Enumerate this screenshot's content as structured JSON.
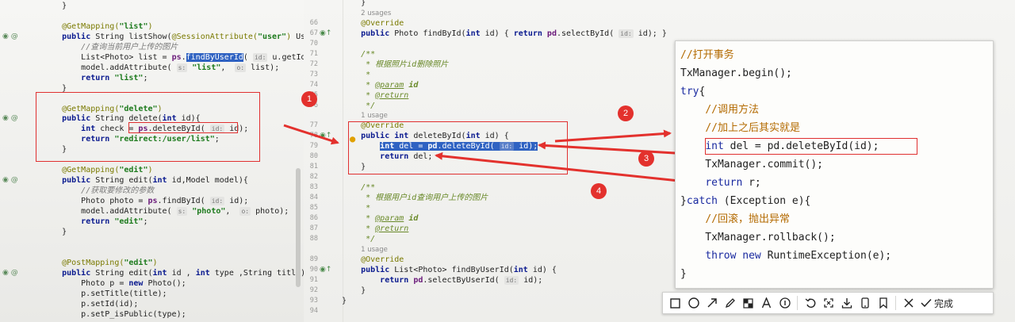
{
  "left_code": {
    "lines": [
      {
        "n": "",
        "html": "    }"
      },
      {
        "n": "",
        "html": ""
      },
      {
        "n": "",
        "html": "    <span class='tk-ann'>@GetMapping(</span><span class='tk-str'>\"list\"</span><span class='tk-ann'>)</span>"
      },
      {
        "n": "",
        "html": "    <span class='tk-kw'>public</span> String listShow(<span class='tk-ann'>@SessionAttribute(</span><span class='tk-str'>\"user\"</span><span class='tk-ann'>)</span> Use"
      },
      {
        "n": "",
        "html": "        <span class='tk-cmt'>//查询当前用户上传的图片</span>"
      },
      {
        "n": "",
        "html": "        List&lt;Photo&gt; list = <span class='tk-field'>ps</span>.<span class='tk-sel'>findByUserId</span>( <span class='tk-hint'>id:</span> u.getId()"
      },
      {
        "n": "",
        "html": "        model.addAttribute( <span class='tk-hint'>s:</span> <span class='tk-str'>\"list\"</span>,  <span class='tk-hint'>o:</span> list);"
      },
      {
        "n": "",
        "html": "        <span class='tk-kw'>return</span> <span class='tk-str'>\"list\"</span>;"
      },
      {
        "n": "",
        "html": "    }"
      },
      {
        "n": "",
        "html": ""
      },
      {
        "n": "",
        "html": "    <span class='tk-ann'>@GetMapping(</span><span class='tk-str'>\"delete\"</span><span class='tk-ann'>)</span>"
      },
      {
        "n": "",
        "html": "    <span class='tk-kw'>public</span> String delete(<span class='tk-kw'>int</span> id){"
      },
      {
        "n": "",
        "html": "        <span class='tk-kw'>int</span> check = <span class='tk-field'>ps</span>.deleteById( <span class='tk-hint'>id:</span> id);"
      },
      {
        "n": "",
        "html": "        <span class='tk-kw'>return</span> <span class='tk-str'>\"redirect:/user/list\"</span>;"
      },
      {
        "n": "",
        "html": "    }"
      },
      {
        "n": "",
        "html": ""
      },
      {
        "n": "",
        "html": "    <span class='tk-ann'>@GetMapping(</span><span class='tk-str'>\"edit\"</span><span class='tk-ann'>)</span>"
      },
      {
        "n": "",
        "html": "    <span class='tk-kw'>public</span> String edit(<span class='tk-kw'>int</span> id,Model model){"
      },
      {
        "n": "",
        "html": "        <span class='tk-cmt'>//获取要修改的参数</span>"
      },
      {
        "n": "",
        "html": "        Photo photo = <span class='tk-field'>ps</span>.findById( <span class='tk-hint'>id:</span> id);"
      },
      {
        "n": "",
        "html": "        model.addAttribute( <span class='tk-hint'>s:</span> <span class='tk-str'>\"photo\"</span>,  <span class='tk-hint'>o:</span> photo);"
      },
      {
        "n": "",
        "html": "        <span class='tk-kw'>return</span> <span class='tk-str'>\"edit\"</span>;"
      },
      {
        "n": "",
        "html": "    }"
      },
      {
        "n": "",
        "html": ""
      },
      {
        "n": "",
        "html": ""
      },
      {
        "n": "",
        "html": "    <span class='tk-ann'>@PostMapping(</span><span class='tk-str'>\"edit\"</span><span class='tk-ann'>)</span>"
      },
      {
        "n": "",
        "html": "    <span class='tk-kw'>public</span> String edit(<span class='tk-kw'>int</span> id , <span class='tk-kw'>int</span> type ,String title){"
      },
      {
        "n": "",
        "html": "        Photo p = <span class='tk-kw'>new</span> Photo();"
      },
      {
        "n": "",
        "html": "        p.setTitle(title);"
      },
      {
        "n": "",
        "html": "        p.setId(id);"
      },
      {
        "n": "",
        "html": "        p.setP_isPublic(type);"
      }
    ]
  },
  "right_code": {
    "lines": [
      {
        "n": "",
        "html": "    }"
      },
      {
        "n": "",
        "html": "    <span class='tk-usage'>2 usages</span>"
      },
      {
        "n": "66",
        "html": "    <span class='tk-ann'>@Override</span>"
      },
      {
        "n": "67",
        "html": "    <span class='tk-kw'>public</span> Photo findById(<span class='tk-kw'>int</span> id) { <span class='tk-kw'>return</span> <span class='tk-field'>pd</span>.selectById( <span class='tk-hint'>id:</span> id); }"
      },
      {
        "n": "70",
        "html": ""
      },
      {
        "n": "71",
        "html": "    <span class='tk-doc'>/**</span>"
      },
      {
        "n": "72",
        "html": "     <span class='tk-doc'>* 根据照片id删除照片</span>"
      },
      {
        "n": "73",
        "html": "     <span class='tk-doc'>*</span>"
      },
      {
        "n": "74",
        "html": "     <span class='tk-doc'>* <u>@param</u></span> <span class='tk-doc' style='font-weight:bold'>id</span>"
      },
      {
        "n": "75",
        "html": "     <span class='tk-doc'>* <u>@return</u></span>"
      },
      {
        "n": "76",
        "html": "     <span class='tk-doc'>*/</span>"
      },
      {
        "n": "",
        "html": "    <span class='tk-usage'>1 usage</span>"
      },
      {
        "n": "77",
        "html": "    <span class='tk-ann'>@Override</span>"
      },
      {
        "n": "78",
        "html": "    <span class='tk-kw'>public</span> <span class='tk-kw'>int</span> deleteById(<span class='tk-kw'>int</span> id) {"
      },
      {
        "n": "79",
        "html": "        <span class='tk-sel'><span class='tk-kw' style='color:#fff'>int</span> del = <span style='color:#fff;font-weight:bold'>pd</span>.deleteById( <span class='tk-hint'>id:</span> id);</span>"
      },
      {
        "n": "80",
        "html": "        <span class='tk-kw'>return</span> del;"
      },
      {
        "n": "81",
        "html": "    }"
      },
      {
        "n": "82",
        "html": ""
      },
      {
        "n": "83",
        "html": "    <span class='tk-doc'>/**</span>"
      },
      {
        "n": "84",
        "html": "     <span class='tk-doc'>* 根据用户id查询用户上传的图片</span>"
      },
      {
        "n": "85",
        "html": "     <span class='tk-doc'>*</span>"
      },
      {
        "n": "86",
        "html": "     <span class='tk-doc'>* <u>@param</u></span> <span class='tk-doc' style='font-weight:bold'>id</span>"
      },
      {
        "n": "87",
        "html": "     <span class='tk-doc'>* <u>@return</u></span>"
      },
      {
        "n": "88",
        "html": "     <span class='tk-doc'>*/</span>"
      },
      {
        "n": "",
        "html": "    <span class='tk-usage'>1 usage</span>"
      },
      {
        "n": "89",
        "html": "    <span class='tk-ann'>@Override</span>"
      },
      {
        "n": "90",
        "html": "    <span class='tk-kw'>public</span> List&lt;Photo&gt; findByUserId(<span class='tk-kw'>int</span> id) {"
      },
      {
        "n": "91",
        "html": "        <span class='tk-kw'>return</span> <span class='tk-field'>pd</span>.selectByUserId( <span class='tk-hint'>id:</span> id);"
      },
      {
        "n": "92",
        "html": "    }"
      },
      {
        "n": "93",
        "html": "}"
      },
      {
        "n": "94",
        "html": ""
      }
    ]
  },
  "popup_code": {
    "lines": [
      "<span class='p-cmt'>//打开事务</span>",
      "TxManager.begin();",
      "<span class='p-kw'>try</span>{",
      "    <span class='p-cmt'>//调用方法</span>",
      "    <span class='p-cmt'>//加上之后其实就是</span>",
      "    <span class='p-kw'>int</span> del = pd.deleteById(id);",
      "    TxManager.commit();",
      "    <span class='p-kw'>return</span> r;",
      "}<span class='p-kw'>catch</span> (Exception e){",
      "    <span class='p-cmt'>//回滚，抛出异常</span>",
      "    TxManager.rollback();",
      "    <span class='p-kw'>throw</span> <span class='p-kw'>new</span> RuntimeException(e);",
      "}"
    ]
  },
  "badges": [
    "1",
    "2",
    "3",
    "4"
  ],
  "toolbar": {
    "tools": [
      "rectangle-icon",
      "ellipse-icon",
      "arrow-icon",
      "pencil-icon",
      "mosaic-icon",
      "text-icon",
      "number-icon",
      "undo-icon",
      "crop-icon",
      "download-icon",
      "phone-icon",
      "pin-icon",
      "close-icon"
    ],
    "done_label": "完成"
  },
  "colors": {
    "annotation_red": "#e3312d",
    "selection_blue": "#2f62c2"
  }
}
